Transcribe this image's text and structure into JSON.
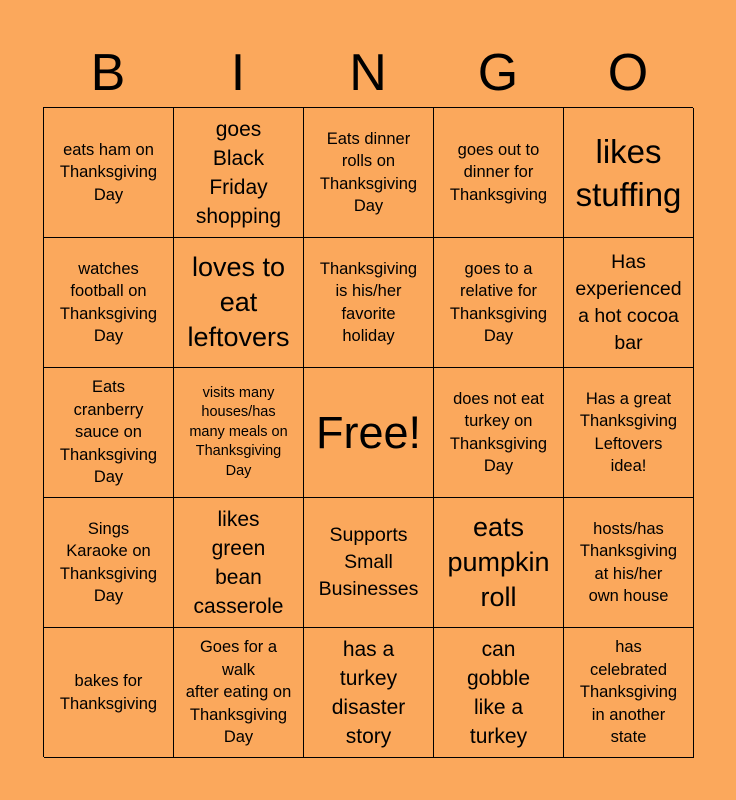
{
  "header": {
    "letters": [
      "B",
      "I",
      "N",
      "G",
      "O"
    ]
  },
  "background_color": "#fba85c",
  "board": {
    "rows": [
      [
        "eats ham on\nThanksgiving\nDay",
        "goes\nBlack\nFriday\nshopping",
        "Eats dinner\nrolls on\nThanksgiving\nDay",
        "goes out to\ndinner for\nThanksgiving",
        "likes\nstuffing"
      ],
      [
        "watches\nfootball on\nThanksgiving\nDay",
        "loves to\neat\nleftovers",
        "Thanksgiving\nis his/her\nfavorite\nholiday",
        "goes to a\nrelative for\nThanksgiving\nDay",
        "Has\nexperienced\na hot cocoa\nbar"
      ],
      [
        "Eats\ncranberry\nsauce on\nThanksgiving\nDay",
        "visits many\nhouses/has\nmany meals on\nThanksgiving\nDay",
        "Free!",
        "does not eat\nturkey on\nThanksgiving\nDay",
        "Has a great\nThanksgiving\nLeftovers\nidea!"
      ],
      [
        "Sings\nKaraoke on\nThanksgiving\nDay",
        "likes\ngreen\nbean\ncasserole",
        "Supports\nSmall\nBusinesses",
        "eats\npumpkin\nroll",
        "hosts/has\nThanksgiving\nat his/her\nown house"
      ],
      [
        "bakes for\nThanksgiving",
        "Goes for a\nwalk\nafter eating on\nThanksgiving\nDay",
        "has a\nturkey\ndisaster\nstory",
        "can\ngobble\nlike a\nturkey",
        "has\ncelebrated\nThanksgiving\nin another\nstate"
      ]
    ]
  }
}
